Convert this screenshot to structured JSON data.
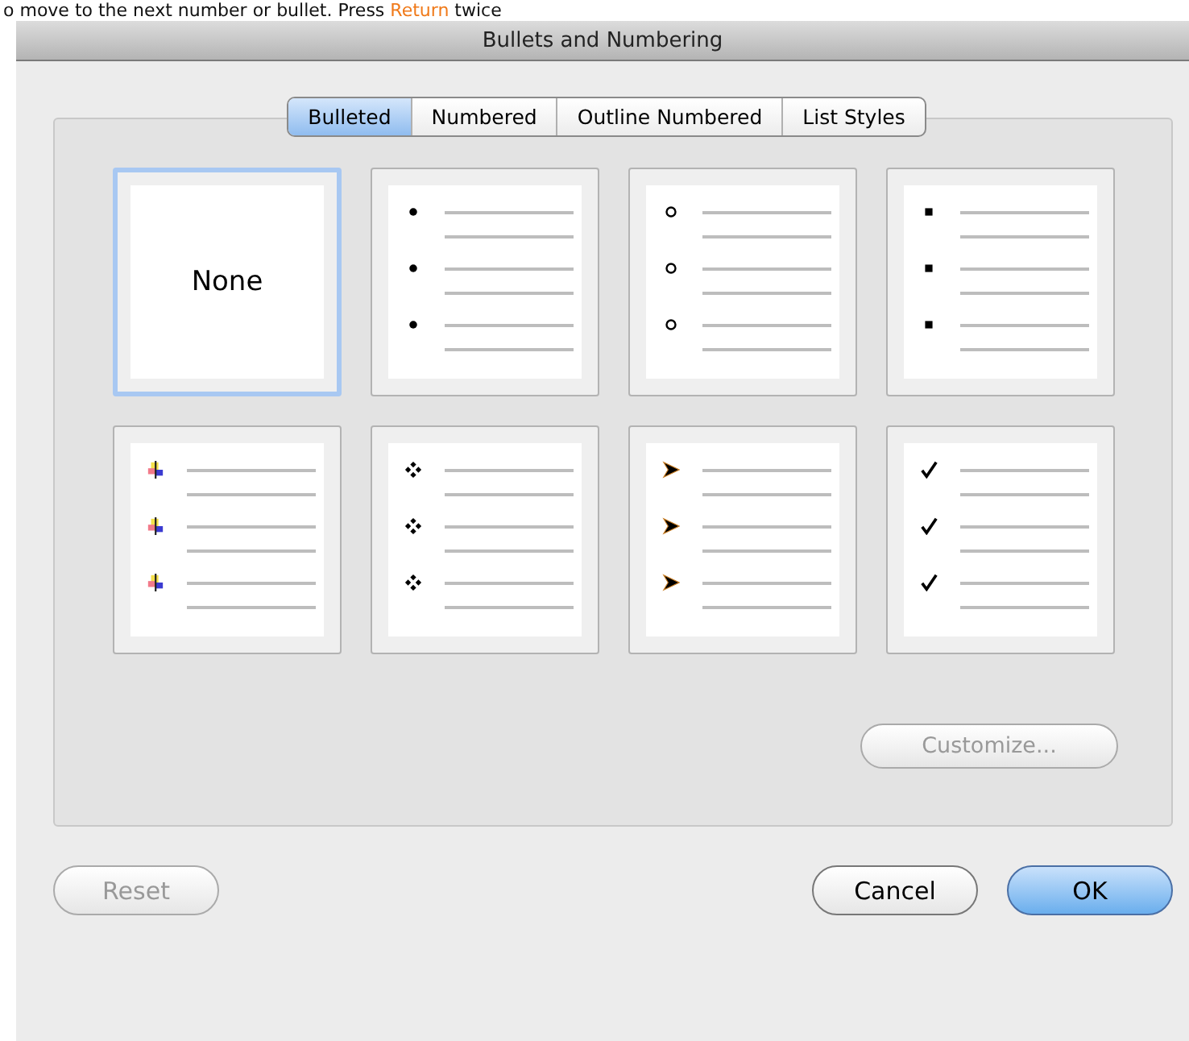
{
  "instruction": {
    "before": "o move to the next number or bullet. Press ",
    "highlight": "Return",
    "after": " twice"
  },
  "window": {
    "title": "Bullets and Numbering"
  },
  "tabs": [
    {
      "label": "Bulleted",
      "selected": true
    },
    {
      "label": "Numbered",
      "selected": false
    },
    {
      "label": "Outline Numbered",
      "selected": false
    },
    {
      "label": "List Styles",
      "selected": false
    }
  ],
  "styles": [
    {
      "kind": "none",
      "label": "None",
      "selected": true
    },
    {
      "kind": "dot",
      "selected": false
    },
    {
      "kind": "circle",
      "selected": false
    },
    {
      "kind": "square",
      "selected": false
    },
    {
      "kind": "plus",
      "selected": false
    },
    {
      "kind": "diamonds",
      "selected": false
    },
    {
      "kind": "arrowhead",
      "selected": false
    },
    {
      "kind": "check",
      "selected": false
    }
  ],
  "customize": {
    "label": "Customize...",
    "disabled": true
  },
  "buttons": [
    {
      "label": "Reset",
      "disabled": true,
      "default": false
    },
    {
      "label": "Cancel",
      "disabled": false,
      "default": false
    },
    {
      "label": "OK",
      "disabled": false,
      "default": true
    }
  ]
}
